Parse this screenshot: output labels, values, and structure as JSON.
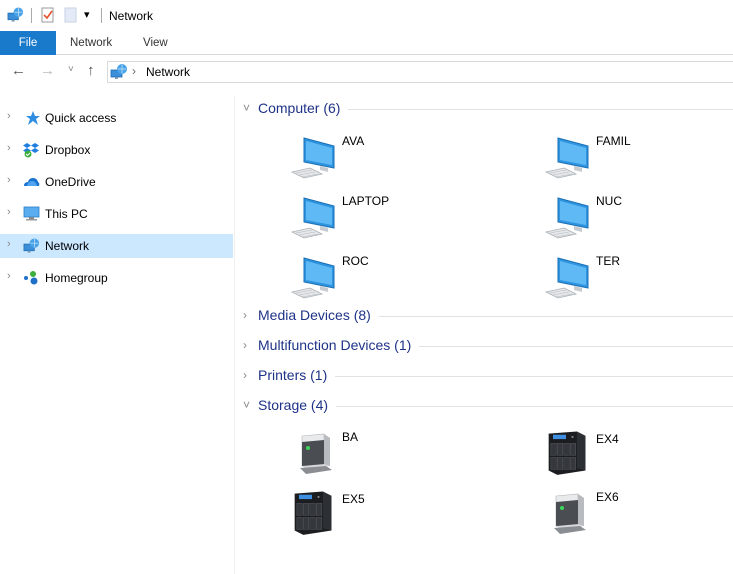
{
  "window": {
    "title": "Network",
    "quick_access_toolbar": [
      "network-icon",
      "properties-icon",
      "new-folder-icon",
      "customize-dropdown-icon"
    ]
  },
  "ribbon": {
    "tabs": [
      {
        "label": "File",
        "active": true
      },
      {
        "label": "Network"
      },
      {
        "label": "View"
      }
    ]
  },
  "navigation": {
    "back_icon": "←",
    "forward_icon": "→",
    "recent_icon": "˅",
    "up_icon": "↑",
    "address": {
      "separator": "›",
      "path": "Network"
    }
  },
  "sidebar": {
    "items": [
      {
        "label": "Quick access",
        "icon": "quick-access-star-icon"
      },
      {
        "label": "Dropbox",
        "icon": "dropbox-icon"
      },
      {
        "label": "OneDrive",
        "icon": "onedrive-icon"
      },
      {
        "label": "This PC",
        "icon": "this-pc-icon"
      },
      {
        "label": "Network",
        "icon": "network-icon",
        "selected": true
      },
      {
        "label": "Homegroup",
        "icon": "homegroup-icon"
      }
    ]
  },
  "groups": [
    {
      "label": "Computer (6)",
      "expanded": true,
      "items": [
        {
          "name": "AVA",
          "type": "computer"
        },
        {
          "name": "FAMIL",
          "type": "computer"
        },
        {
          "name": "LAPTOP",
          "type": "computer"
        },
        {
          "name": "NUC",
          "type": "computer"
        },
        {
          "name": "ROC",
          "type": "computer"
        },
        {
          "name": "TER",
          "type": "computer"
        }
      ]
    },
    {
      "label": "Media Devices (8)",
      "expanded": false
    },
    {
      "label": "Multifunction Devices (1)",
      "expanded": false
    },
    {
      "label": "Printers (1)",
      "expanded": false
    },
    {
      "label": "Storage (4)",
      "expanded": true,
      "items": [
        {
          "name": "BA",
          "type": "drive"
        },
        {
          "name": "EX4",
          "type": "nas"
        },
        {
          "name": "EX5",
          "type": "nas"
        },
        {
          "name": "EX6",
          "type": "drive"
        }
      ]
    }
  ],
  "chevrons": {
    "collapsed": "›",
    "expanded": "˅"
  }
}
